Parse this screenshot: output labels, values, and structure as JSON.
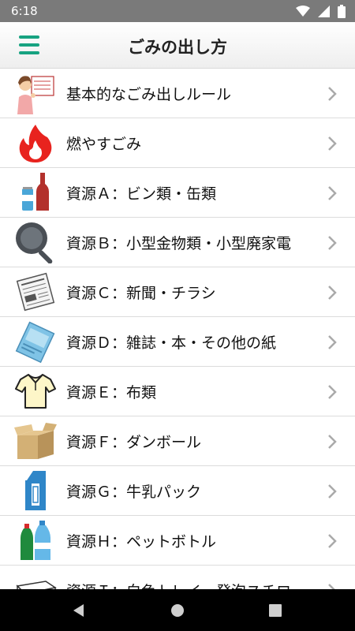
{
  "status_bar": {
    "time": "6:18"
  },
  "app_bar": {
    "title": "ごみの出し方"
  },
  "items": [
    {
      "label": "基本的なごみ出しルール",
      "icon": "woman-with-chart-icon"
    },
    {
      "label": "燃やすごみ",
      "icon": "flame-icon"
    },
    {
      "label": "資源Ａ：ビン類・缶類",
      "icon": "can-and-bottle-icon"
    },
    {
      "label": "資源Ｂ：小型金物類・小型廃家電",
      "icon": "frying-pan-icon"
    },
    {
      "label": "資源Ｃ：新聞・チラシ",
      "icon": "newspaper-icon"
    },
    {
      "label": "資源Ｄ：雑誌・本・その他の紙",
      "icon": "magazine-icon"
    },
    {
      "label": "資源Ｅ：布類",
      "icon": "shirt-icon"
    },
    {
      "label": "資源Ｆ：ダンボール",
      "icon": "cardboard-box-icon"
    },
    {
      "label": "資源Ｇ：牛乳パック",
      "icon": "milk-carton-icon"
    },
    {
      "label": "資源Ｈ：ペットボトル",
      "icon": "pet-bottle-icon"
    },
    {
      "label": "資源Ｉ：白色トレイ・発泡スチロー",
      "icon": "foam-tray-icon"
    }
  ],
  "colors": {
    "accent": "#17a381",
    "status_bar": "#7a7a7a",
    "nav_bar": "#000000"
  }
}
